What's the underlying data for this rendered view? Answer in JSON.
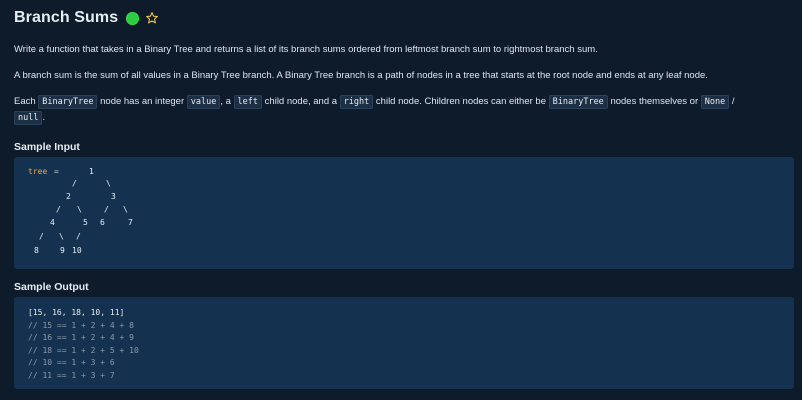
{
  "header": {
    "title": "Branch Sums",
    "status_color": "#2ecc40",
    "status_icon": "completed-dot-icon",
    "favorite_icon": "star-outline-icon"
  },
  "description": {
    "p1": "Write a function that takes in a Binary Tree and returns a list of its branch sums ordered from leftmost branch sum to rightmost branch sum.",
    "p2": "A branch sum is the sum of all values in a Binary Tree branch. A Binary Tree branch is a path of nodes in a tree that starts at the root node and ends at any leaf node.",
    "p3": {
      "t1": "Each",
      "c1": "BinaryTree",
      "t2": "node has an integer",
      "c2": "value",
      "t3": ", a",
      "c3": "left",
      "t4": "child node, and a",
      "c4": "right",
      "t5": "child node. Children nodes can either be",
      "c5": "BinaryTree",
      "t6": "nodes themselves or",
      "c6": "None",
      "t7": "/",
      "c7": "null",
      "t8": "."
    }
  },
  "sample_input": {
    "label": "Sample Input",
    "var": "tree",
    "eq": "=",
    "nodes": [
      "1",
      "2",
      "3",
      "4",
      "5",
      "6",
      "7",
      "8",
      "9",
      "10"
    ],
    "edges": [
      "/",
      "\\",
      "/",
      "\\",
      "/",
      "\\",
      "/",
      "\\",
      "/"
    ]
  },
  "sample_output": {
    "label": "Sample Output",
    "result": "[15, 16, 18, 10, 11]",
    "comments": [
      "// 15 == 1 + 2 + 4 + 8",
      "// 16 == 1 + 2 + 4 + 9",
      "// 18 == 1 + 2 + 5 + 10",
      "// 10 == 1 + 3 + 6",
      "// 11 == 1 + 3 + 7"
    ]
  }
}
